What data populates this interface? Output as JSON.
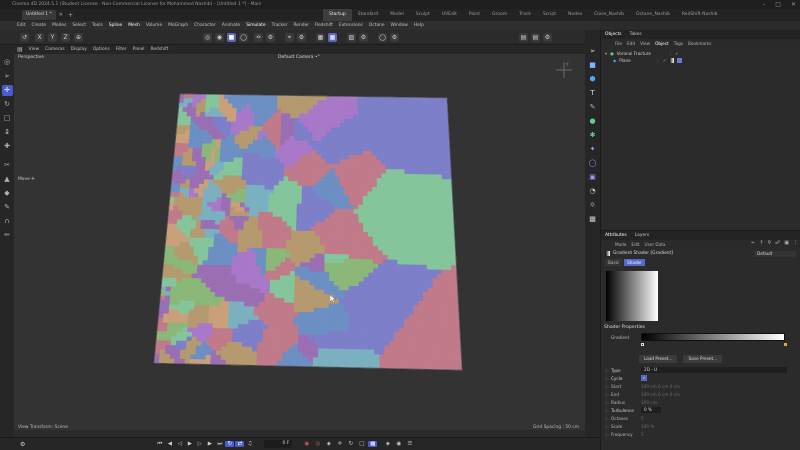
{
  "window": {
    "title": "Cinema 4D 2024.5.1 (Student License - Non-Commercial License for Mohammed Nashib) - [Untitled 1 *] - Main",
    "doc_tab": "Untitled 1 *"
  },
  "layouts": [
    "Startup",
    "Standard",
    "Model",
    "Sculpt",
    "UVEdit",
    "Paint",
    "Groom",
    "Track",
    "Script",
    "Nodes",
    "Close_Nashib",
    "Octane_Nashib",
    "RedShift Nashib"
  ],
  "menu": [
    "Edit",
    "Create",
    "Modes",
    "Select",
    "Tools",
    "Spline",
    "Mesh",
    "Volume",
    "MoGraph",
    "Character",
    "Animate",
    "Simulate",
    "Tracker",
    "Render",
    "Redshift",
    "Extensions",
    "Octane",
    "Window",
    "Help"
  ],
  "menu_highlight": [
    "Spline",
    "Mesh",
    "Simulate"
  ],
  "viewport_menu": [
    "View",
    "Cameras",
    "Display",
    "Options",
    "Filter",
    "Panel",
    "Redshift"
  ],
  "viewport": {
    "label": "Perspective",
    "camera": "Default Camera •°",
    "status": "View Transform: Scene",
    "grid": "Grid Spacing : 50 cm",
    "tooltip": "Move ✛"
  },
  "objects_panel": {
    "tabs": [
      "Objects",
      "Takes"
    ],
    "menu": [
      "File",
      "Edit",
      "View",
      "Object",
      "Tags",
      "Bookmarks"
    ],
    "items": [
      {
        "name": "Voronoi Fracture",
        "indent": 0
      },
      {
        "name": "Plane",
        "indent": 1
      }
    ]
  },
  "attributes_panel": {
    "tabs": [
      "Attributes",
      "Layers"
    ],
    "menu": [
      "Mode",
      "Edit",
      "User Data"
    ],
    "header": "Gradient Shader [Gradient]",
    "dropdown": "Default",
    "subtabs": [
      "Basic",
      "Shader"
    ],
    "section": "Shader Properties",
    "gradient_label": "Gradient",
    "buttons": [
      "Load Preset...",
      "Save Preset..."
    ],
    "props": [
      {
        "label": "Type",
        "value": "2D - U"
      },
      {
        "label": "Cycle",
        "value": "✓"
      },
      {
        "label": "Start",
        "value": "100 cm    0 cm    0 cm"
      },
      {
        "label": "End",
        "value": "100 cm    0 cm    0 cm"
      },
      {
        "label": "Radius",
        "value": "100 cm"
      },
      {
        "label": "Turbulence",
        "value": "0 %"
      },
      {
        "label": "Octaves",
        "value": "5"
      },
      {
        "label": "Scale",
        "value": "100 %"
      },
      {
        "label": "Frequency",
        "value": "1"
      }
    ]
  },
  "timeline": {
    "frame": "0 F"
  },
  "colors": {
    "accent": "#4a5bd0",
    "cells": [
      "#9b6fb3",
      "#7ab0c0",
      "#8bb878",
      "#c07a8a",
      "#b59a6f",
      "#6c8fc4",
      "#a978c9",
      "#84c59c",
      "#c9a07a",
      "#7d7fc9"
    ]
  }
}
